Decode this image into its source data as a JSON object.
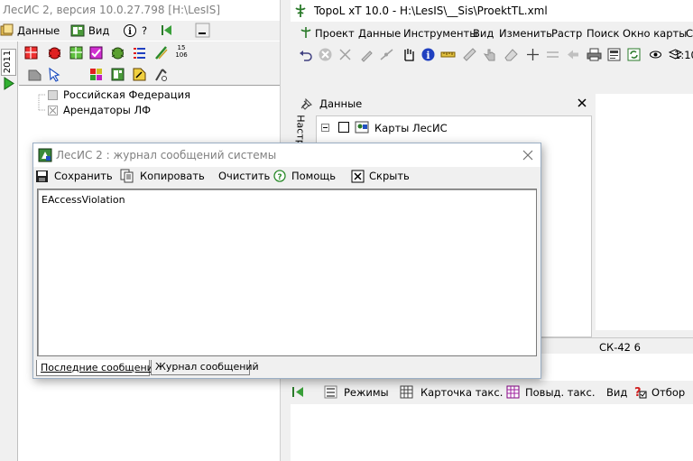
{
  "left_window": {
    "title": "ЛесИС 2, версия 10.0.27.798  [H:\\LesIS]",
    "menu": {
      "data": "Данные",
      "view": "Вид",
      "help": "?"
    },
    "year_tab": "2011",
    "cell_badge": [
      "15",
      "106"
    ],
    "tree": [
      {
        "label": "Российская Федерация"
      },
      {
        "label": "Арендаторы ЛФ"
      }
    ]
  },
  "right_window": {
    "title": "TopoL xT 10.0 - H:\\LesIS\\__Sis\\ProektTL.xml",
    "menu": [
      "Проект",
      "Данные",
      "Инструменты",
      "Вид",
      "Изменить",
      "Растр",
      "Поиск",
      "Окно карты",
      "С"
    ],
    "scale_text": "1:10",
    "data_panel": {
      "title": "Данные",
      "side_tab": "Настр",
      "tree_root": "Карты ЛесИС"
    },
    "status_coord": "СК-42 6",
    "bottom_toolbar": {
      "modes": "Режимы",
      "card": "Карточка такс.",
      "povyd": "Повыд. такс.",
      "view": "Вид",
      "select": "Отбор"
    }
  },
  "dialog": {
    "title": "ЛесИС 2 : журнал сообщений системы",
    "toolbar": {
      "save": "Сохранить",
      "copy": "Копировать",
      "clear": "Очистить",
      "help": "Помощь",
      "hide": "Скрыть"
    },
    "log_text": "EAccessViolation",
    "tabs": {
      "recent": "Последние сообщения",
      "journal": "Журнал сообщений"
    }
  },
  "colors": {
    "panel": "#f0f0f0",
    "border": "#a0a0a0",
    "title_gray": "#808080",
    "accent_green": "#4caf24",
    "magenta": "#c020c0"
  }
}
